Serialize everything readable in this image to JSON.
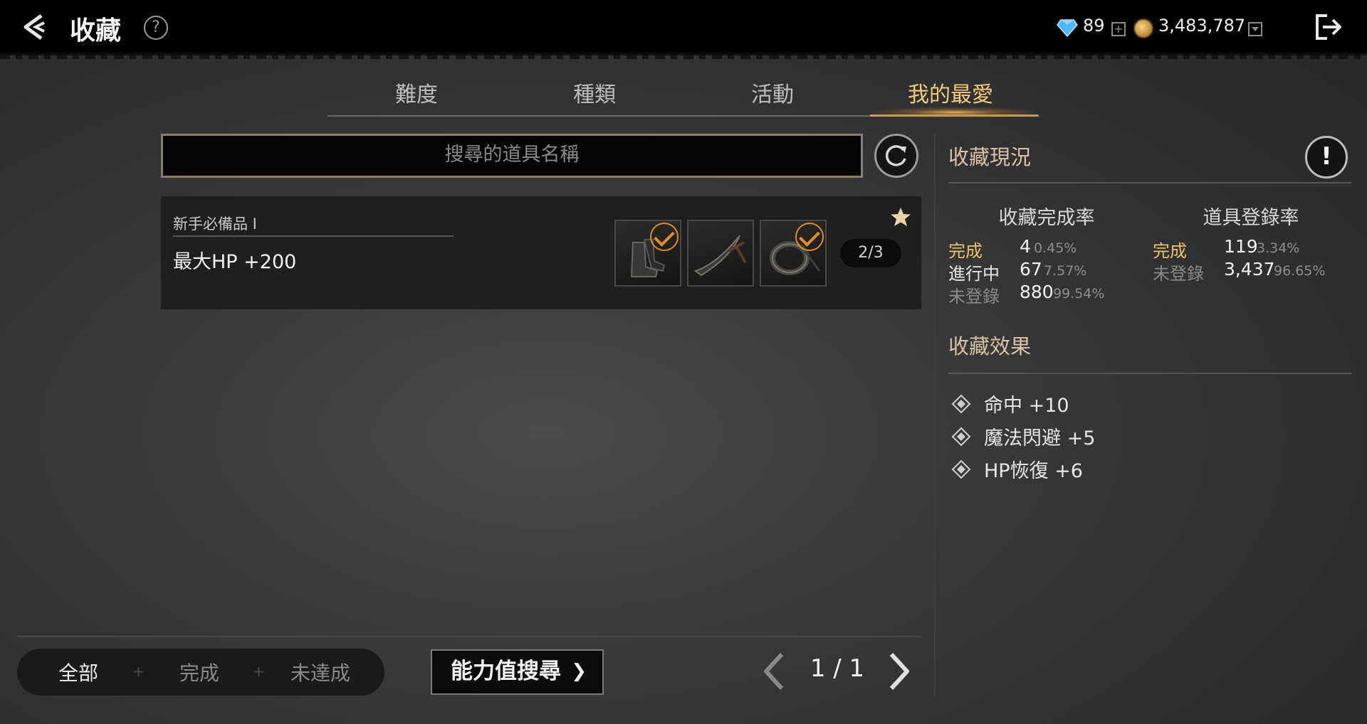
{
  "header": {
    "title": "收藏",
    "gems": "89",
    "gold": "3,483,787"
  },
  "tabs": [
    {
      "label": "難度",
      "active": false
    },
    {
      "label": "種類",
      "active": false
    },
    {
      "label": "活動",
      "active": false
    },
    {
      "label": "我的最愛",
      "active": true
    }
  ],
  "search": {
    "placeholder": "搜尋的道具名稱"
  },
  "items": [
    {
      "category": "新手必備品 I",
      "effect": "最大HP +200",
      "count": "2/3",
      "favorite": true,
      "slots": [
        {
          "icon": "boots-icon",
          "collected": true
        },
        {
          "icon": "scimitar-icon",
          "collected": false
        },
        {
          "icon": "ring-icon",
          "collected": true
        }
      ]
    }
  ],
  "filters": {
    "all": "全部",
    "done": "完成",
    "incomplete": "未達成",
    "active": "全部"
  },
  "stat_search_label": "能力值搜尋",
  "pagination": {
    "current": 1,
    "total": 1,
    "text": "1 / 1"
  },
  "status": {
    "title": "收藏現況",
    "completion": {
      "title": "收藏完成率",
      "rows": [
        {
          "label": "完成",
          "value": "4",
          "pct": "0.45%"
        },
        {
          "label": "進行中",
          "value": "67",
          "pct": "7.57%"
        },
        {
          "label": "未登錄",
          "value": "880",
          "pct": "99.54%"
        }
      ]
    },
    "registration": {
      "title": "道具登錄率",
      "rows": [
        {
          "label": "完成",
          "value": "119",
          "pct": "3.34%"
        },
        {
          "label": "未登錄",
          "value": "3,437",
          "pct": "96.65%"
        }
      ]
    }
  },
  "effects": {
    "title": "收藏效果",
    "list": [
      "命中 +10",
      "魔法閃避 +5",
      "HP恢復 +6"
    ]
  },
  "colors": {
    "accent_gold": "#f3c97a",
    "check_orange": "#e08b2c",
    "label_done": "#e8c36a"
  }
}
